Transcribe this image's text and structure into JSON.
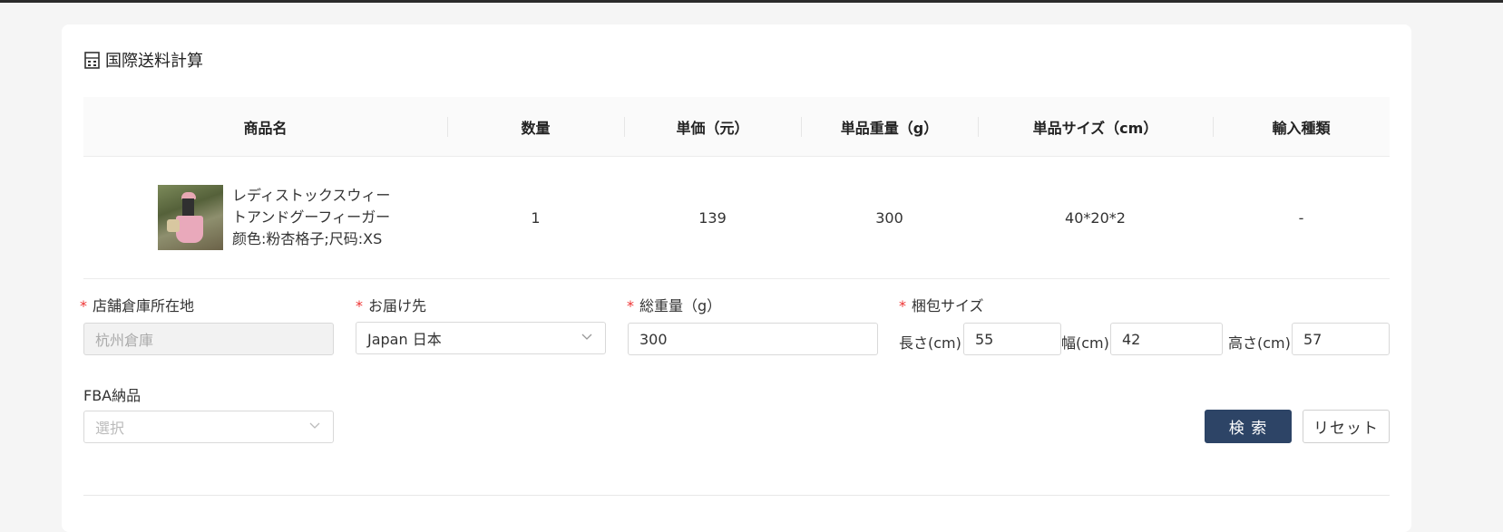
{
  "title": "国際送料計算",
  "table": {
    "headers": [
      "商品名",
      "数量",
      "単価（元）",
      "単品重量（g）",
      "単品サイズ（cm）",
      "輸入種類"
    ],
    "row": {
      "name_line1": "レディストックスウィー",
      "name_line2": "トアンドグーフィーガー",
      "name_line3": "颜色:粉杏格子;尺码:XS",
      "quantity": "1",
      "unit_price": "139",
      "unit_weight": "300",
      "unit_size": "40*20*2",
      "import_type": "-"
    }
  },
  "form": {
    "warehouse": {
      "label": "店舗倉庫所在地",
      "value": "杭州倉庫"
    },
    "destination": {
      "label": "お届け先",
      "value": "Japan 日本"
    },
    "total_weight": {
      "label": "総重量（g）",
      "value": "300"
    },
    "package_size": {
      "label": "梱包サイズ",
      "length_label": "長さ(cm)",
      "length": "55",
      "width_label": "幅(cm)",
      "width": "42",
      "height_label": "高さ(cm)",
      "height": "57"
    },
    "fba": {
      "label": "FBA納品",
      "placeholder": "選択"
    },
    "required_mark": "*"
  },
  "buttons": {
    "search": "検 索",
    "reset": "リセット"
  },
  "icons": {
    "title_icon": "calculator-icon",
    "dropdown_icon": "chevron-down-icon"
  },
  "colors": {
    "primary": "#2d4466",
    "required": "#e33333"
  }
}
